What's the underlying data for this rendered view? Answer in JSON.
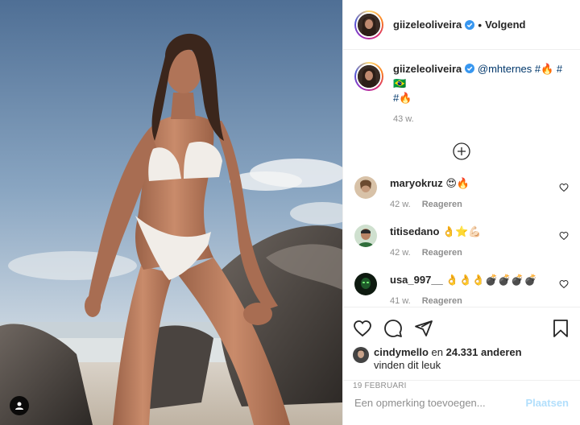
{
  "post": {
    "author": "giizeleoliveira",
    "follow_status": "Volgend",
    "separator": "•"
  },
  "caption": {
    "username": "giizeleoliveira",
    "mention": "@mhternes",
    "text_line1": " #🔥 #🇧🇷",
    "text_line2": "#🔥",
    "age": "43 w."
  },
  "comments": [
    {
      "username": "maryokruz",
      "text": " 😍🔥",
      "age": "42 w.",
      "reply": "Reageren"
    },
    {
      "username": "titisedano",
      "text": " 👌⭐💪🏻",
      "age": "42 w.",
      "reply": "Reageren"
    },
    {
      "username": "usa_997__",
      "text": " 👌👌👌💣💣💣💣",
      "age": "41 w.",
      "reply": "Reageren"
    }
  ],
  "likes": {
    "liker": "cindymello",
    "joiner": " en ",
    "others": "24.331 anderen",
    "suffix": "vinden dit leuk"
  },
  "date": "19 februari",
  "comment_box": {
    "placeholder": "Een opmerking toevoegen...",
    "post_label": "Plaatsen"
  },
  "colors": {
    "hashtag": "#00376b",
    "verified": "#3897f0",
    "post_button_disabled": "#b2dffc",
    "meta_gray": "#8e8e8e"
  }
}
